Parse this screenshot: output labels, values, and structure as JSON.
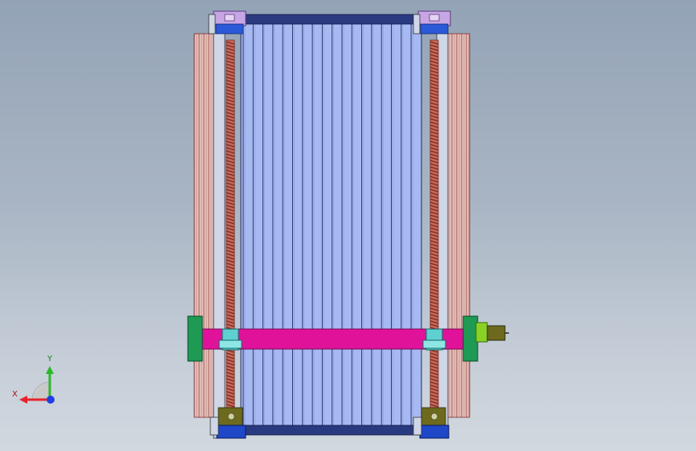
{
  "viewport": {
    "background_top": "#93a3b6",
    "background_bottom": "#d2d8df"
  },
  "model": {
    "colors": {
      "bed_fill": "#a7b9f2",
      "bed_line": "#1d2a5a",
      "gantry": "#e0129a",
      "rail": "#e9c5c0",
      "rail_line": "#7a2a2a",
      "screw": "#7a2a22",
      "screw_core": "#c86a5a",
      "motor_mount": "#c8a6e6",
      "bottom_block": "#1e48c8",
      "bearing": "#5fd0d0",
      "motor_body": "#6d6a1e",
      "green_block": "#1e9a54",
      "lime": "#8ad126"
    }
  },
  "triad": {
    "x_label": "X",
    "y_label": "Y",
    "x_color": "#e8202a",
    "y_color": "#2ab82a",
    "z_color": "#2040e0"
  }
}
